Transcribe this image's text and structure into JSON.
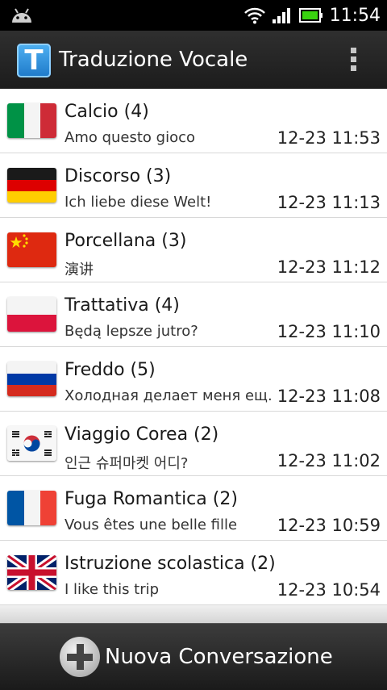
{
  "status_bar": {
    "time": "11:54"
  },
  "app_bar": {
    "icon_letter": "T",
    "title": "Traduzione Vocale"
  },
  "conversations": [
    {
      "flag": "italy-flag",
      "title": "Calcio (4)",
      "subtitle": "Amo questo gioco",
      "time": "12-23 11:53"
    },
    {
      "flag": "germany-flag",
      "title": "Discorso (3)",
      "subtitle": "Ich liebe diese Welt!",
      "time": "12-23 11:13"
    },
    {
      "flag": "china-flag",
      "title": "Porcellana (3)",
      "subtitle": "演讲",
      "time": "12-23 11:12"
    },
    {
      "flag": "poland-flag",
      "title": "Trattativa (4)",
      "subtitle": "Będą lepsze jutro?",
      "time": "12-23 11:10"
    },
    {
      "flag": "russia-flag",
      "title": "Freddo (5)",
      "subtitle": "Холодная делает меня ещ.",
      "time": "12-23 11:08"
    },
    {
      "flag": "korea-flag",
      "title": "Viaggio Corea (2)",
      "subtitle": "인근 슈퍼마켓 어디?",
      "time": "12-23 11:02"
    },
    {
      "flag": "france-flag",
      "title": "Fuga Romantica (2)",
      "subtitle": "Vous êtes une belle fille",
      "time": "12-23 10:59"
    },
    {
      "flag": "uk-flag",
      "title": "Istruzione scolastica (2)",
      "subtitle": "I like this trip",
      "time": "12-23 10:54"
    }
  ],
  "bottom_bar": {
    "new_label": "Nuova Conversazione"
  },
  "colors": {
    "app_bar": "#262626",
    "app_icon": "#2f8fe0",
    "battery": "#39d40f"
  }
}
